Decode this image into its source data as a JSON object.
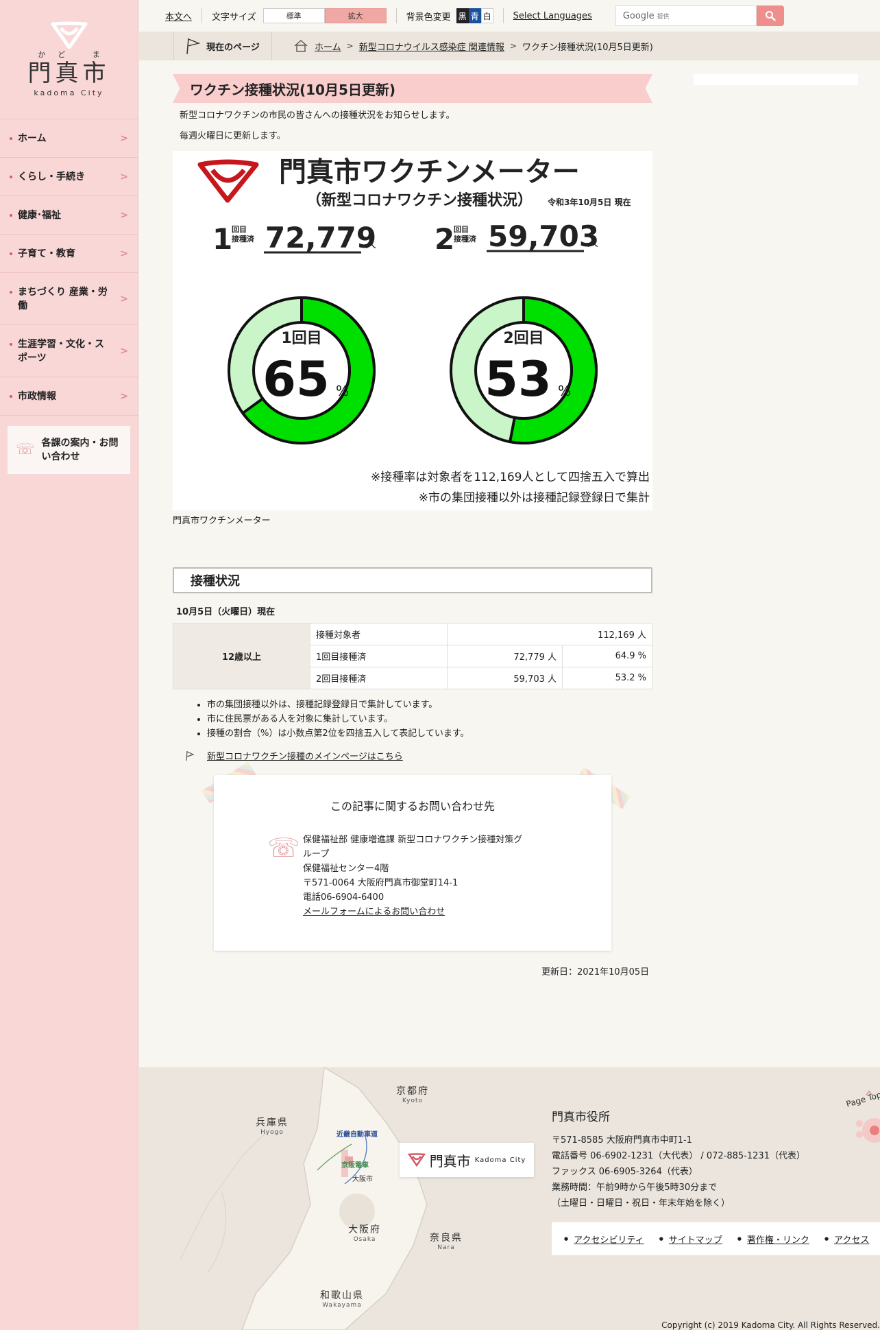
{
  "topbar": {
    "skip_link": "本文へ",
    "font_size_label": "文字サイズ",
    "font_standard": "標準",
    "font_large": "拡大",
    "bg_label": "背景色変更",
    "bg_black": "黒",
    "bg_blue": "青",
    "bg_white": "白",
    "languages": "Select Languages",
    "search_brand": "Google",
    "search_suffix": "提供"
  },
  "logo": {
    "ruby": "かど ま",
    "kanji": "門真市",
    "roman": "kadoma City"
  },
  "sidebar": {
    "items": [
      {
        "label": "ホーム"
      },
      {
        "label": "くらし・手続き"
      },
      {
        "label": "健康･福祉"
      },
      {
        "label": "子育て・教育"
      },
      {
        "label": "まちづくり 産業・労働"
      },
      {
        "label": "生涯学習・文化・スポーツ"
      },
      {
        "label": "市政情報"
      }
    ],
    "contact": "各課の案内・お問い合わせ"
  },
  "breadcrumb": {
    "label": "現在のページ",
    "home": "ホーム",
    "parent": "新型コロナウイルス感染症 関連情報",
    "current": "ワクチン接種状況(10月5日更新)"
  },
  "page": {
    "title": "ワクチン接種状況(10月5日更新)",
    "intro1": "新型コロナワクチンの市民の皆さんへの接種状況をお知らせします。",
    "intro2": "毎週火曜日に更新します。",
    "meter_caption": "門真市ワクチンメーター"
  },
  "meter": {
    "title": "門真市ワクチンメーター",
    "subtitle": "（新型コロナワクチン接種状況）",
    "date": "令和3年10月5日 現在",
    "dose1": {
      "num": "1",
      "label_a": "回目",
      "label_b": "接種済",
      "count": "72,779",
      "unit": "人",
      "ring_label": "1回目",
      "percent": 65,
      "percent_text": "65"
    },
    "dose2": {
      "num": "2",
      "label_a": "回目",
      "label_b": "接種済",
      "count": "59,703",
      "unit": "人",
      "ring_label": "2回目",
      "percent": 53,
      "percent_text": "53"
    },
    "pct_sign": "%",
    "note1": "※接種率は対象者を112,169人として四捨五入で算出",
    "note2": "※市の集団接種以外は接種記録登録日で集計",
    "fill_color": "#00e000",
    "remain_color": "#c9f5c9"
  },
  "status": {
    "heading": "接種状況",
    "as_of": "10月5日（火曜日）現在",
    "group": "12歳以上",
    "rows": [
      {
        "label": "接種対象者",
        "count": "112,169 人",
        "pct": ""
      },
      {
        "label": "1回目接種済",
        "count": "72,779 人",
        "pct": "64.9 %"
      },
      {
        "label": "2回目接種済",
        "count": "59,703 人",
        "pct": "53.2 %"
      }
    ],
    "notes": [
      "市の集団接種以外は、接種記録登録日で集計しています。",
      "市に住民票がある人を対象に集計しています。",
      "接種の割合（%）は小数点第2位を四捨五入して表記しています。"
    ],
    "main_link": "新型コロナワクチン接種のメインページはこちら"
  },
  "inquiry": {
    "heading": "この記事に関するお問い合わせ先",
    "dept": "保健福祉部 健康増進課 新型コロナワクチン接種対策グループ",
    "place": "保健福祉センター4階",
    "address": "〒571-0064 大阪府門真市御堂町14-1",
    "phone": "電話06-6904-6400",
    "mail_link": "メールフォームによるお問い合わせ"
  },
  "updated": "更新日：2021年10月05日",
  "footer": {
    "map": {
      "kyoto": "京都府",
      "kyoto_en": "Kyoto",
      "hyogo": "兵庫県",
      "hyogo_en": "Hyogo",
      "osaka": "大阪府",
      "osaka_en": "Osaka",
      "nara": "奈良県",
      "nara_en": "Nara",
      "wakayama": "和歌山県",
      "wakayama_en": "Wakayama",
      "kinki_expressway": "近畿自動車道",
      "keihan": "京阪電車",
      "osaka_city": "大阪市",
      "card_kanji": "門真市",
      "card_roman": "Kadoma City"
    },
    "office_title": "門真市役所",
    "address": "〒571-8585 大阪府門真市中町1-1",
    "phone": "電話番号 06-6902-1231（大代表） / 072-885-1231（代表）",
    "fax": "ファックス 06-6905-3264（代表）",
    "hours": "業務時間：午前9時から午後5時30分まで",
    "hours_note": "（土曜日・日曜日・祝日・年末年始を除く）",
    "links": [
      "アクセシビリティ",
      "サイトマップ",
      "著作権・リンク",
      "アクセス"
    ],
    "copyright": "Copyright (c) 2019 Kadoma City. All Rights Reserved.",
    "page_top": "Page Top"
  }
}
